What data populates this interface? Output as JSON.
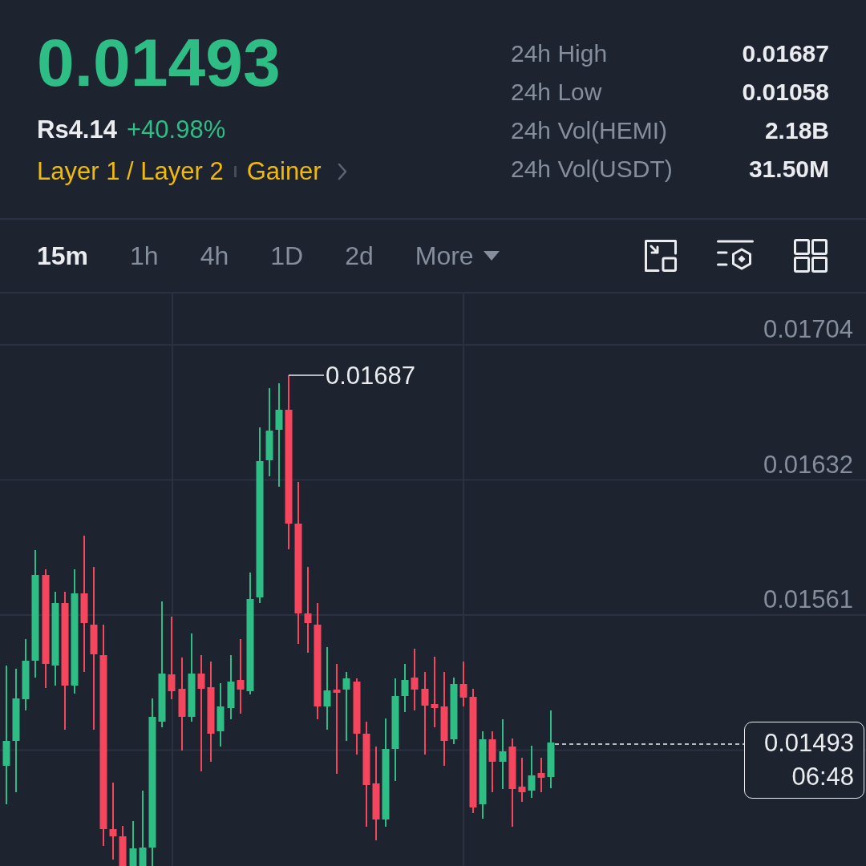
{
  "ticker": {
    "last_price": "0.01493",
    "rising": true,
    "fiat_price": "Rs4.14",
    "change": "+40.98%",
    "tags": [
      "Layer 1 / Layer 2",
      "Gainer"
    ]
  },
  "stats": [
    {
      "label": "24h High",
      "value": "0.01687"
    },
    {
      "label": "24h Low",
      "value": "0.01058"
    },
    {
      "label": "24h Vol(HEMI)",
      "value": "2.18B"
    },
    {
      "label": "24h Vol(USDT)",
      "value": "31.50M"
    }
  ],
  "intervals": [
    {
      "label": "15m",
      "selected": true
    },
    {
      "label": "1h",
      "selected": false
    },
    {
      "label": "4h",
      "selected": false
    },
    {
      "label": "1D",
      "selected": false
    },
    {
      "label": "2d",
      "selected": false
    }
  ],
  "more_menu": {
    "label": "More"
  },
  "chart": {
    "price_axis": [
      "0.01704",
      "0.01632",
      "0.01561"
    ],
    "high_marker": "0.01687",
    "last_price": "0.01493",
    "countdown": "06:48"
  }
}
